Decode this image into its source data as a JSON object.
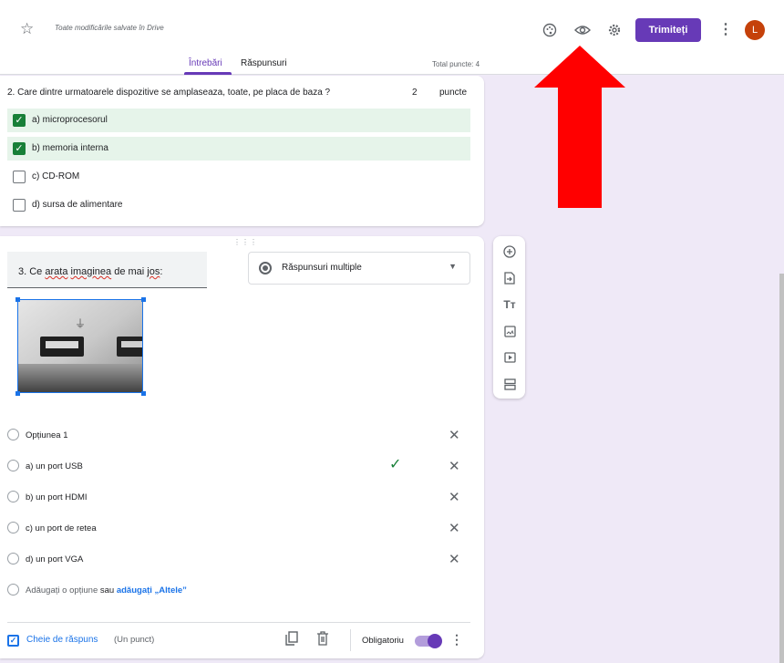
{
  "header": {
    "saved_status": "Toate modificările salvate în Drive",
    "send_label": "Trimiteți",
    "avatar_initial": "L",
    "icons": [
      "star-icon",
      "palette-icon",
      "eye-icon",
      "gear-icon",
      "more-vert-icon"
    ]
  },
  "tabs": {
    "questions": "Întrebări",
    "responses": "Răspunsuri",
    "total_points": "Total puncte: 4"
  },
  "question2": {
    "text": "2. Care dintre urmatoarele dispozitive se amplaseaza, toate, pe placa de baza ?",
    "points": "2",
    "points_label": "puncte",
    "options": [
      {
        "label": "a) microprocesorul",
        "checked": true
      },
      {
        "label": "b) memoria interna",
        "checked": true
      },
      {
        "label": "c) CD-ROM",
        "checked": false
      },
      {
        "label": "d) sursa de alimentare",
        "checked": false
      }
    ]
  },
  "question3": {
    "title_pre": "3. Ce ",
    "title_w1": "arata",
    "title_mid": " ",
    "title_w2": "imaginea",
    "title_w3": " de mai ",
    "title_w4": "jos",
    "title_end": ":",
    "type": "Răspunsuri multiple",
    "options": [
      "Opțiunea 1",
      "a) un port USB",
      "b) un port HDMI",
      "c) un port de retea",
      "d) un port VGA"
    ],
    "add_option": "Adăugați o opțiune",
    "add_or": "sau",
    "add_other": "adăugați „Altele”",
    "answer_key": "Cheie de răspuns",
    "answer_points": "(Un punct)",
    "required": "Obligatoriu"
  },
  "colors": {
    "accent": "#673ab7",
    "correct_bg": "#e6f4ea",
    "check_green": "#188038",
    "link_blue": "#1a73e8",
    "annotation_red": "#ff0000"
  }
}
